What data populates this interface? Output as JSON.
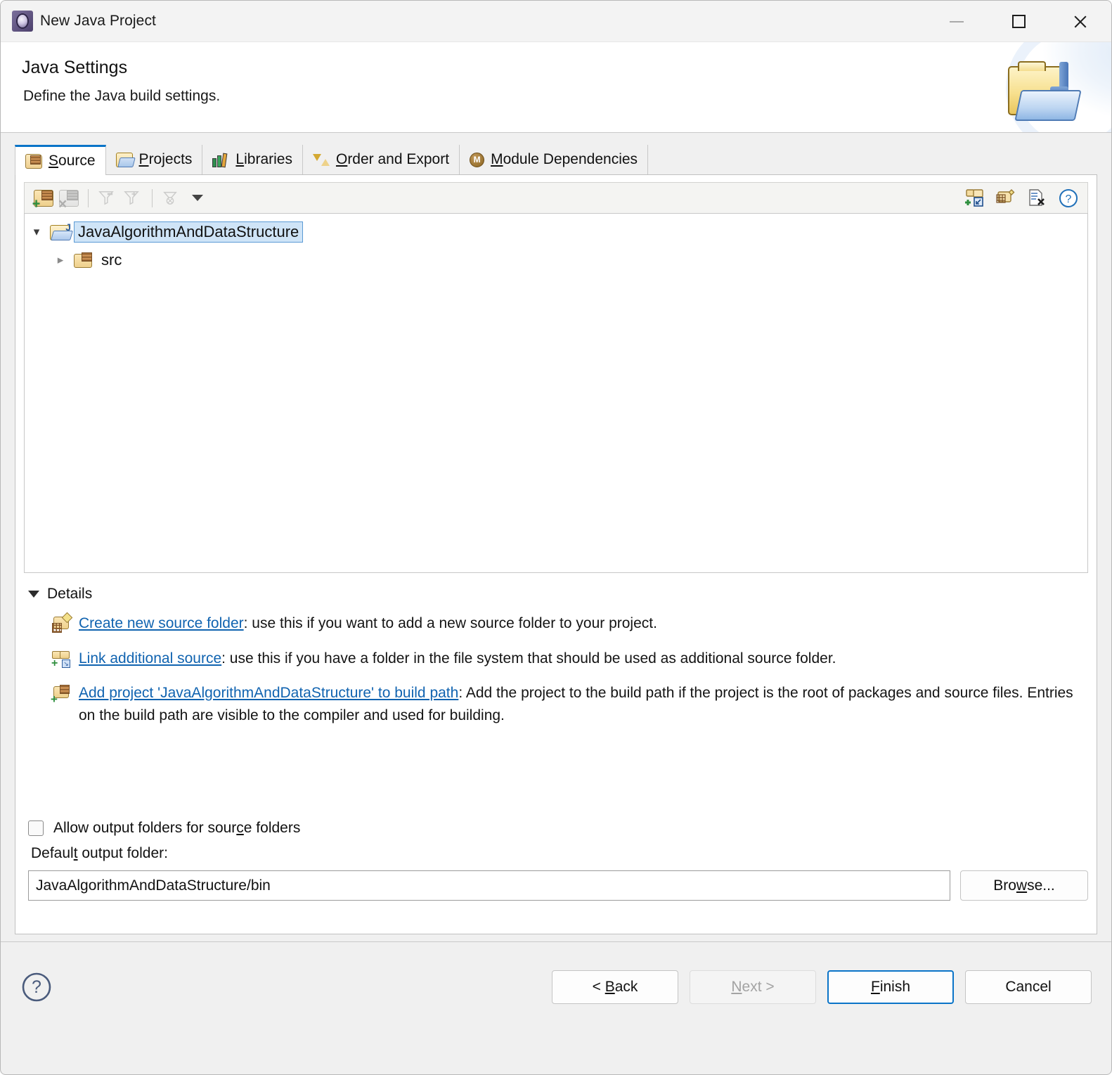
{
  "window": {
    "title": "New Java Project",
    "icon": "eclipse-wizard-icon",
    "controls": {
      "minimize": "—",
      "maximize": "□",
      "close": "✕"
    }
  },
  "banner": {
    "title": "Java Settings",
    "subtitle": "Define the Java build settings.",
    "icon": "java-folder-banner-icon"
  },
  "tabs": [
    {
      "label": "Source",
      "mnemonic": "S",
      "icon": "source-folder-icon",
      "active": true
    },
    {
      "label": "Projects",
      "mnemonic": "P",
      "icon": "projects-folder-icon",
      "active": false
    },
    {
      "label": "Libraries",
      "mnemonic": "L",
      "icon": "libraries-books-icon",
      "active": false
    },
    {
      "label": "Order and Export",
      "mnemonic": "O",
      "icon": "order-export-arrows-icon",
      "active": false
    },
    {
      "label": "Module Dependencies",
      "mnemonic": "M",
      "icon": "module-dependencies-icon",
      "active": false
    }
  ],
  "toolbar": {
    "left": [
      {
        "name": "add-source-folder-icon",
        "enabled": true
      },
      {
        "name": "remove-source-folder-icon",
        "enabled": false
      },
      {
        "name": "filter-icon",
        "enabled": false
      },
      {
        "name": "add-filter-icon",
        "enabled": false
      },
      {
        "name": "edit-filter-icon",
        "enabled": false
      },
      {
        "name": "view-menu-dropdown-icon",
        "enabled": true
      }
    ],
    "right": [
      {
        "name": "link-source-icon",
        "enabled": true
      },
      {
        "name": "create-new-folder-icon",
        "enabled": true
      },
      {
        "name": "remove-entry-icon",
        "enabled": true
      },
      {
        "name": "help-icon",
        "enabled": true
      }
    ]
  },
  "tree": {
    "root": {
      "label": "JavaAlgorithmAndDataStructure",
      "expanded": true,
      "selected": true,
      "icon": "java-project-folder-icon"
    },
    "children": [
      {
        "label": "src",
        "expanded": false,
        "selected": false,
        "icon": "source-package-folder-icon"
      }
    ]
  },
  "details": {
    "heading": "Details",
    "expanded": true,
    "items": [
      {
        "icon": "create-new-source-folder-icon",
        "link": "Create new source folder",
        "description": ": use this if you want to add a new source folder to your project."
      },
      {
        "icon": "link-additional-source-icon",
        "link": "Link additional source",
        "description": ": use this if you have a folder in the file system that should be used as additional source folder."
      },
      {
        "icon": "add-project-to-build-path-icon",
        "link": "Add project 'JavaAlgorithmAndDataStructure' to build path",
        "description": ": Add the project to the build path if the project is the root of packages and source files. Entries on the build path are visible to the compiler and used for building."
      }
    ]
  },
  "options": {
    "allow_output_folders": {
      "label_before": "Allow output folders for sour",
      "label_mnemonic": "c",
      "label_after": "e folders",
      "checked": false
    },
    "default_output_folder": {
      "label_before": "Defaul",
      "label_mnemonic": "t",
      "label_after": " output folder:",
      "value": "JavaAlgorithmAndDataStructure/bin",
      "browse_before": "Bro",
      "browse_mnemonic": "w",
      "browse_after": "se..."
    }
  },
  "footer": {
    "help_icon": "help-icon",
    "buttons": [
      {
        "name": "back",
        "before": "< ",
        "mnemonic": "B",
        "after": "ack",
        "enabled": true,
        "default": false
      },
      {
        "name": "next",
        "before": "",
        "mnemonic": "N",
        "after": "ext >",
        "enabled": false,
        "default": false
      },
      {
        "name": "finish",
        "before": "",
        "mnemonic": "F",
        "after": "inish",
        "enabled": true,
        "default": true
      },
      {
        "name": "cancel",
        "before": "",
        "mnemonic": "",
        "after": "Cancel",
        "enabled": true,
        "default": false
      }
    ]
  },
  "colors": {
    "accent": "#0a74c8",
    "link": "#1063b0",
    "selection": "#cfe4f7",
    "dialog_bg": "#f0f0f0"
  }
}
